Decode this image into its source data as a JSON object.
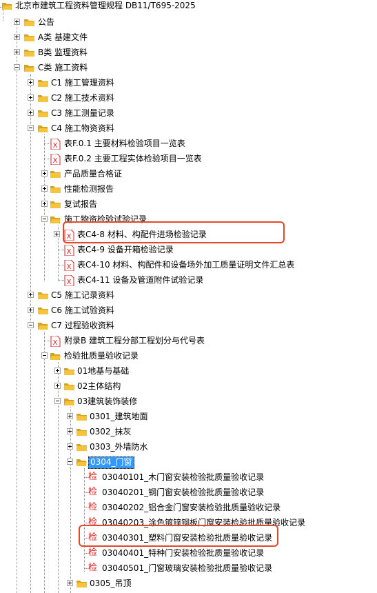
{
  "tree": {
    "root": {
      "label": "北京市建筑工程资料管理规程 DB11/T695-2025"
    },
    "n_gonggao": {
      "label": "公告"
    },
    "n_a": {
      "label": "A类 基建文件"
    },
    "n_b": {
      "label": "B类 监理资料"
    },
    "n_c": {
      "label": "C类 施工资料"
    },
    "n_c1": {
      "label": "C1 施工管理资料"
    },
    "n_c2": {
      "label": "C2 施工技术资料"
    },
    "n_c3": {
      "label": "C3 施工测量记录"
    },
    "n_c4": {
      "label": "C4 施工物资资料"
    },
    "n_f01": {
      "label": "表F.0.1 主要材料检验项目一览表"
    },
    "n_f02": {
      "label": "表F.0.2 主要工程实体检验项目一览表"
    },
    "n_cert": {
      "label": "产品质量合格证"
    },
    "n_perf": {
      "label": "性能检测报告"
    },
    "n_retest": {
      "label": "复试报告"
    },
    "n_matrec": {
      "label": "施工物资检验试验记录"
    },
    "n_c48": {
      "label": "表C4-8 材料、构配件进场检验记录"
    },
    "n_c49": {
      "label": "表C4-9 设备开箱检验记录"
    },
    "n_c410": {
      "label": "表C4-10 材料、构配件和设备场外加工质量证明文件汇总表"
    },
    "n_c411": {
      "label": "表C4-11 设备及管道附件试验记录"
    },
    "n_c5": {
      "label": "C5 施工记录资料"
    },
    "n_c6": {
      "label": "C6 施工试验资料"
    },
    "n_c7": {
      "label": "C7 过程验收资料"
    },
    "n_appb": {
      "label": "附录B 建筑工程分部工程划分与代号表"
    },
    "n_batch": {
      "label": "检验批质量验收记录"
    },
    "n_01": {
      "label": "01地基与基础"
    },
    "n_02": {
      "label": "02主体结构"
    },
    "n_03": {
      "label": "03建筑装饰装修"
    },
    "n_0301": {
      "label": "0301_建筑地面"
    },
    "n_0302": {
      "label": "0302_抹灰"
    },
    "n_0303": {
      "label": "0303_外墙防水"
    },
    "n_0304": {
      "label": "0304_门窗"
    },
    "n_f101": {
      "label": "03040101_木门窗安装检验批质量验收记录"
    },
    "n_f201": {
      "label": "03040201_钢门窗安装检验批质量验收记录"
    },
    "n_f202": {
      "label": "03040202_铝合金门窗安装检验批质量验收记录"
    },
    "n_f203": {
      "label": "03040203_涂色镀锌钢板门窗安装检验批质量验收记录"
    },
    "n_f301": {
      "label": "03040301_塑料门窗安装检验批质量验收记录"
    },
    "n_f401": {
      "label": "03040401_特种门安装检验批质量验收记录"
    },
    "n_f501": {
      "label": "03040501_门窗玻璃安装检验批质量验收记录"
    },
    "n_0305": {
      "label": "0305_吊顶"
    }
  },
  "icon_glyph_jian": "检",
  "colors": {
    "folder": "#f5c43a",
    "folder_dark": "#d9a21b",
    "doc_x": "#e02020",
    "jian_icon": "#e02020",
    "selection": "#3399ff",
    "highlight": "#e04a2a"
  }
}
